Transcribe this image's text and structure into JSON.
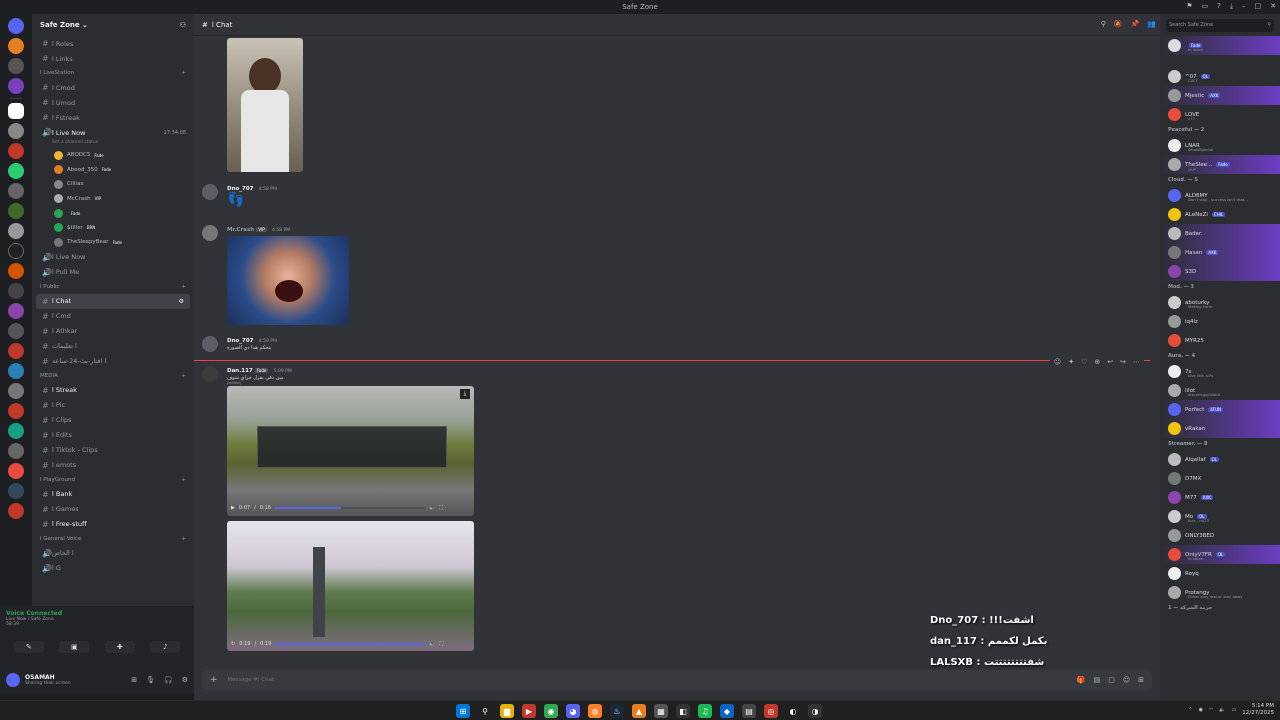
{
  "window": {
    "title": "Safe Zone"
  },
  "server": {
    "name": "Safe Zone"
  },
  "channels": {
    "roles": "ا Roles",
    "links": "ا Links",
    "livestation_cat": "ا LiveStation",
    "cmod1": "ا Cmod",
    "umod": "ا Umod",
    "fstreak": "ا Fstreak",
    "live_now": "ا Live Now",
    "live_now_time": "17:34:08",
    "set_status": "Set a channel status",
    "voice_users": [
      {
        "name": "ABODCS",
        "tag": "Fade"
      },
      {
        "name": "Abood_350",
        "tag": "Fade"
      },
      {
        "name": "Cilliax",
        "tag": ""
      },
      {
        "name": "McCrash",
        "tag": "VIP"
      },
      {
        "name": "",
        "tag": "Fade"
      },
      {
        "name": "$tiller",
        "tag": "BRN"
      },
      {
        "name": "TheSleepyBear",
        "tag": "Fade"
      }
    ],
    "live_now2": "ا Live Now",
    "pull_me": "ا Pull Me",
    "public_cat": "ا Public",
    "chat": "ا Chat",
    "cmd": "ا Cmd",
    "athkar": "ا Athkar",
    "ch_arabic1": "ا تعليمات",
    "ch_arabic2": "ا افتار-بث-24-ساعه",
    "media_cat": "MEDIA",
    "streak": "ا Streak",
    "pic": "ا Pic",
    "clips": "ا Clips",
    "edits": "ا Edits",
    "tiktok": "ا Tiktok - Clips",
    "emots": "ا emots",
    "playground_cat": "ا PlayGround",
    "bank": "ا Bank",
    "games": "ا Games",
    "free_stuff": "ا Free-stuff",
    "general_voice_cat": "ا General Voice",
    "g_arabic": "ا الخاص",
    "g": "ا G"
  },
  "voice_panel": {
    "title": "Voice Connected",
    "sub": "Live Now / Safe Zone",
    "time": "58:39"
  },
  "user": {
    "name": "OSAMAH",
    "status": "Sharing their screen"
  },
  "chat": {
    "channel_name": "ا Chat",
    "messages": [
      {
        "name": "Dno_707",
        "time": "4:58 PM",
        "text": "",
        "color": "#dbdee1"
      },
      {
        "name": "Mr.Crash",
        "time": "4:58 PM",
        "text": "",
        "color": "#949ba4"
      },
      {
        "name": "Dno_707",
        "time": "4:59 PM",
        "text": "بتحكم هذا ذي الصوره",
        "color": "#dbdee1"
      },
      {
        "name": "Dan.117",
        "time": "5:09 PM",
        "text": "مين دقي بقرل جراي شوف",
        "color": "#dbdee1"
      }
    ],
    "msg2_tag": "VIP",
    "msg4_tag": "Fade",
    "edited": "(edited)",
    "video1": {
      "current": "0:07",
      "total": "0:16",
      "progress": 0.44
    },
    "video2": {
      "current": "0:19",
      "total": "0:19",
      "progress": 1.0
    },
    "composer_placeholder": "Message #ا Chat"
  },
  "overlay": {
    "lines": [
      "Dno_707 : !!!اشفت",
      "dan_117 : بكمل لكممم",
      "LALSXB : شفتتتتتتتتت"
    ]
  },
  "members": {
    "search_placeholder": "Search Safe Zone",
    "top_member": {
      "name": "",
      "tag": "Fade",
      "status": "In voice"
    },
    "groups": [
      {
        "label": "",
        "members": [
          {
            "name": "^07",
            "tag": "OL",
            "status": "CXCT"
          },
          {
            "name": "Mjestic",
            "tag": "AXK",
            "status": ""
          },
          {
            "name": "LOVE",
            "tag": "",
            "status": "ا ا ة"
          }
        ]
      },
      {
        "label": "Peaceful — 2",
        "members": [
          {
            "name": "LNAR",
            "tag": "",
            "status": "GhostSpectal"
          },
          {
            "name": "TheSlee...",
            "tag": "Fade",
            "status": "حزين"
          }
        ]
      },
      {
        "label": "Cloud. — 5",
        "members": [
          {
            "name": "ALD8MY",
            "tag": "",
            "status": "Don't stop , success isn't that..."
          },
          {
            "name": "ALeNeZi",
            "tag": "CHIL",
            "status": ""
          },
          {
            "name": "Bader.",
            "tag": "",
            "status": ""
          },
          {
            "name": "Hasan",
            "tag": "AXK",
            "status": ""
          },
          {
            "name": "S3D",
            "tag": "",
            "status": ""
          }
        ]
      },
      {
        "label": "Mod. — 3",
        "members": [
          {
            "name": "aboturky",
            "tag": "",
            "status": "Making Form"
          },
          {
            "name": "iq4lz",
            "tag": "",
            "status": ""
          },
          {
            "name": "MYR25",
            "tag": "",
            "status": ""
          }
        ]
      },
      {
        "label": "Aura. — 4",
        "members": [
          {
            "name": "7s",
            "tag": "",
            "status": "Live kick.si7s"
          },
          {
            "name": "lilot",
            "tag": "",
            "status": "discord.gg/WAKU"
          },
          {
            "name": "Perfect",
            "tag": "4FUN",
            "status": ""
          },
          {
            "name": "vRakan",
            "tag": "",
            "status": ""
          }
        ]
      },
      {
        "label": "Streamer. — 8",
        "members": [
          {
            "name": "Alqallaf",
            "tag": "OL",
            "status": ""
          },
          {
            "name": "D7MX",
            "tag": "",
            "status": ""
          },
          {
            "name": "M77",
            "tag": "AXK",
            "status": ""
          },
          {
            "name": "Mo",
            "tag": "OL",
            "status": "kick - mj23"
          },
          {
            "name": "ONLY3BED",
            "tag": "",
            "status": ""
          },
          {
            "name": "OnlyV7FR",
            "tag": "OL",
            "status": "In voice"
          },
          {
            "name": "Royq",
            "tag": "",
            "status": ""
          },
          {
            "name": "Protangy",
            "tag": "",
            "status": "Either stay real or stay away"
          }
        ]
      },
      {
        "label": "حرمة الشركة — 1",
        "members": []
      }
    ]
  },
  "taskbar": {
    "time": "5:14 PM",
    "date": "12/27/2025"
  },
  "colors": {
    "accent": "#5865f2",
    "new_divider": "#f23f43",
    "online": "#23a55a"
  }
}
